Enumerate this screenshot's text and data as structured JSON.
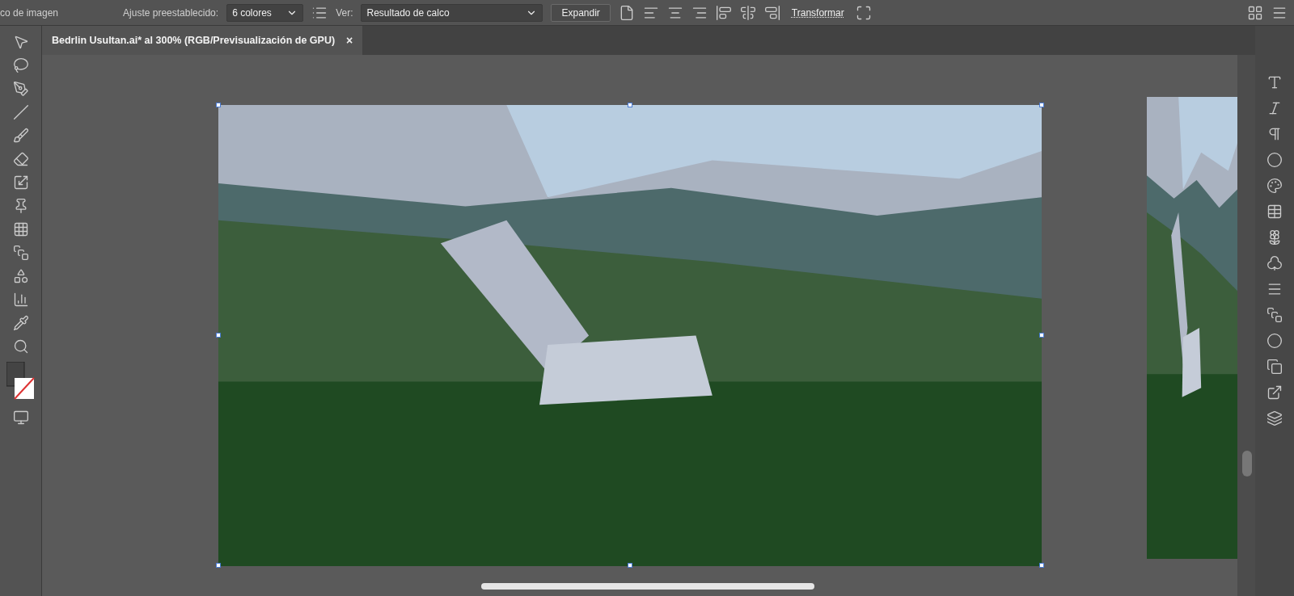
{
  "control_bar": {
    "panel_title": "co de imagen",
    "preset_label": "Ajuste preestablecido:",
    "preset_value": "6 colores",
    "view_label": "Ver:",
    "view_value": "Resultado de calco",
    "expand_button": "Expandir",
    "transform_button": "Transformar"
  },
  "document_tabs": [
    {
      "title": "Bedrlin Usultan.ai* al 300% (RGB/Previsualización de GPU)",
      "close": "×",
      "selected": true
    }
  ]
}
